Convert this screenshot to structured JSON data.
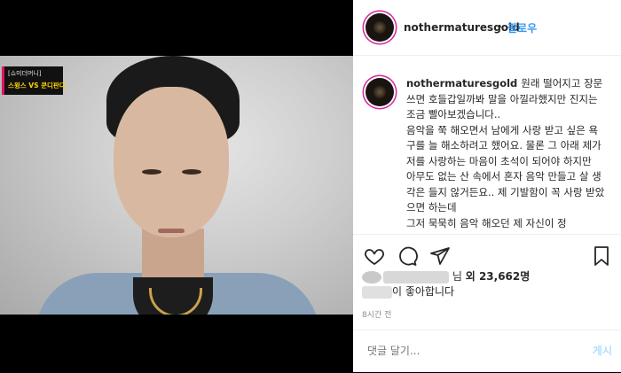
{
  "media": {
    "tag_line1": "[쇼미더머니]",
    "tag_line2": "스윙스 VS 쿤디판다",
    "carousel_count": 3,
    "carousel_active": 2
  },
  "header": {
    "username": "nothermaturesgold",
    "separator": "•",
    "follow_label": "팔로우"
  },
  "caption": {
    "username": "nothermaturesgold",
    "lines": [
      "원래 떨어지고 장문 쓰면 호들갑일까봐 말을 아낄라했지만 진지는 조금 빨아보겠습니다..",
      "음악을 쭉 해오면서 남에게 사랑 받고 싶은 욕구를 늘 해소하려고 했어요. 물론 그 아래 제가 저를 사랑하는 마음이 초석이 되어야 하지만",
      "아무도 없는 산 속에서 혼자 음악 만들고 살 생각은 들지 않거든요.. 제 기발함이 꼭 사랑 받았으면 하는데",
      "그저 묵묵히 음악 해오던 제 자신이 정"
    ]
  },
  "actions": {
    "icons": [
      "heart-icon",
      "comment-icon",
      "share-icon",
      "bookmark-icon"
    ]
  },
  "likes": {
    "suffix_nim": "님",
    "and_label": "외",
    "count": "23,662명",
    "liked_text": "이 좋아합니다"
  },
  "time": "8시간 전",
  "comment": {
    "placeholder": "댓글 달기...",
    "post_label": "게시"
  }
}
